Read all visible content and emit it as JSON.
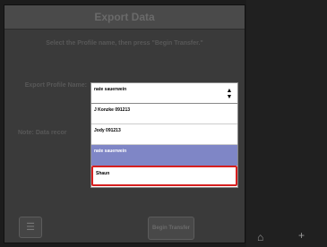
{
  "dialog": {
    "title": "Export Data",
    "instruction": "Select the Profile name, then press \"Begin Transfer.\"",
    "field_label": "Export Profile Name:",
    "note_label": "Note: Data recor",
    "dropdown_value": "nate sauerwein",
    "list_items": [
      "J Konzke 091213",
      "Jody 091213",
      "nate sauerwein",
      "Shaun"
    ],
    "begin_button": "Begin Transfer"
  },
  "icons": {
    "list": "list-icon",
    "dropdown": "up-down-arrows-icon",
    "home": "home-icon",
    "add": "plus-icon"
  }
}
